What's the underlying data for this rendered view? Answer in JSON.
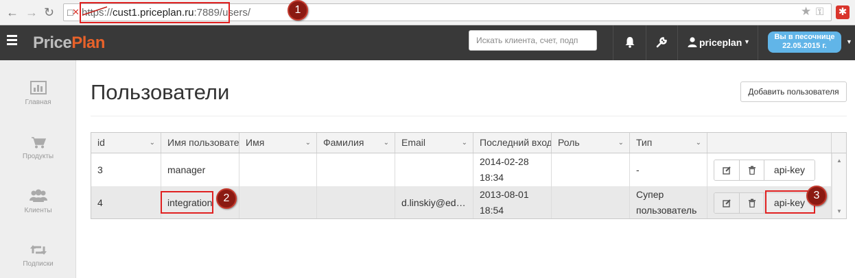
{
  "browser": {
    "url_prefix": "https://",
    "url_host": "cust1.priceplan.ru",
    "url_rest": ":7889/users/"
  },
  "annotations": [
    "1",
    "2",
    "3"
  ],
  "app": {
    "logo_part1": "Price",
    "logo_part2": "Plan",
    "search_placeholder": "Искать клиента, счет, подп",
    "user_name": "priceplan",
    "sandbox_line1": "Вы в песочнице",
    "sandbox_line2": "22.05.2015 г."
  },
  "sidebar": {
    "items": [
      {
        "label": "Главная",
        "icon": "bar-chart-icon"
      },
      {
        "label": "Продукты",
        "icon": "cart-icon"
      },
      {
        "label": "Клиенты",
        "icon": "users-icon"
      },
      {
        "label": "Подписки",
        "icon": "retweet-icon"
      }
    ]
  },
  "page": {
    "title": "Пользователи",
    "add_button": "Добавить пользователя"
  },
  "table": {
    "columns": [
      "id",
      "Имя пользователя",
      "Имя",
      "Фамилия",
      "Email",
      "Последний вход",
      "Роль",
      "Тип",
      ""
    ],
    "rows": [
      {
        "id": "3",
        "username": "manager",
        "first_name": "",
        "last_name": "",
        "email": "",
        "last_login_1": "2014-02-28",
        "last_login_2": "18:34",
        "role": "",
        "type_1": "-",
        "type_2": "",
        "api_label": "api-key"
      },
      {
        "id": "4",
        "username": "integration",
        "first_name": "",
        "last_name": "",
        "email": "d.linskiy@ed…",
        "last_login_1": "2013-08-01",
        "last_login_2": "18:54",
        "role": "",
        "type_1": "Супер",
        "type_2": "пользователь",
        "api_label": "api-key"
      }
    ]
  },
  "colors": {
    "appbar": "#393939",
    "logo_accent": "#e8622a",
    "sandbox_badge": "#61b5e8",
    "annotation": "#e02020"
  }
}
